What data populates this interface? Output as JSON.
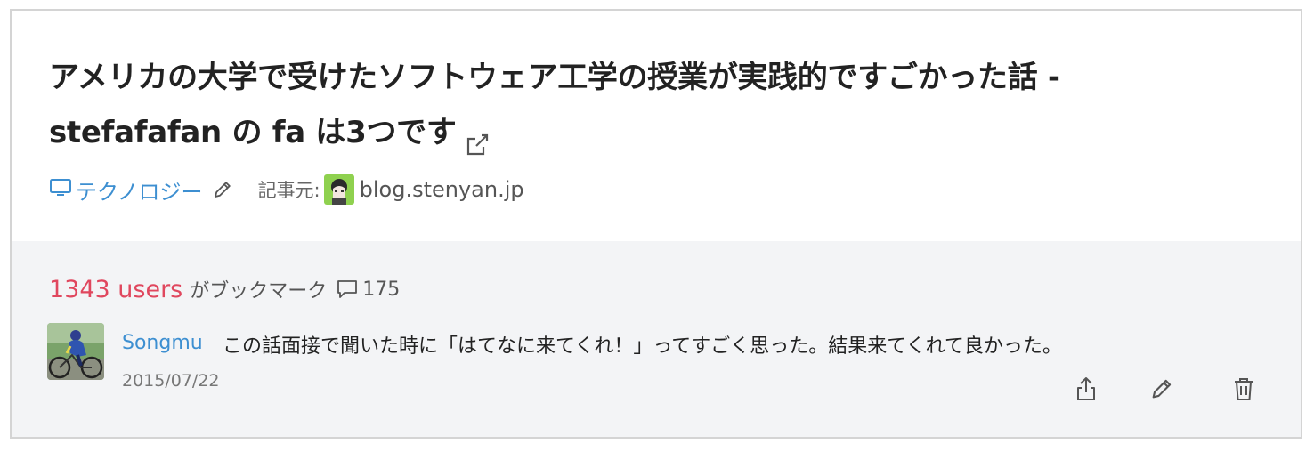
{
  "entry": {
    "title": "アメリカの大学で受けたソフトウェア工学の授業が実践的ですごかった話 - stefafafan の fa は3つです",
    "category": "テクノロジー",
    "source_label": "記事元:",
    "source_domain": "blog.stenyan.jp"
  },
  "stats": {
    "users": "1343 users",
    "bookmark_text": "がブックマーク",
    "comment_count": "175"
  },
  "my_comment": {
    "user": "Songmu",
    "text": "この話面接で聞いた時に「はてなに来てくれ！」ってすごく思った。結果来てくれて良かった。",
    "date": "2015/07/22"
  },
  "icons": {
    "title": "external-link-icon",
    "category": "monitor-icon",
    "edit_category": "pencil-icon",
    "comments": "speech-bubble-icon",
    "share": "share-icon",
    "edit": "pencil-icon",
    "delete": "trash-icon"
  },
  "colors": {
    "link_blue": "#3d8fd1",
    "users_red": "#e0475e",
    "panel_gray": "#f3f4f6",
    "border": "#d4d4d4"
  }
}
